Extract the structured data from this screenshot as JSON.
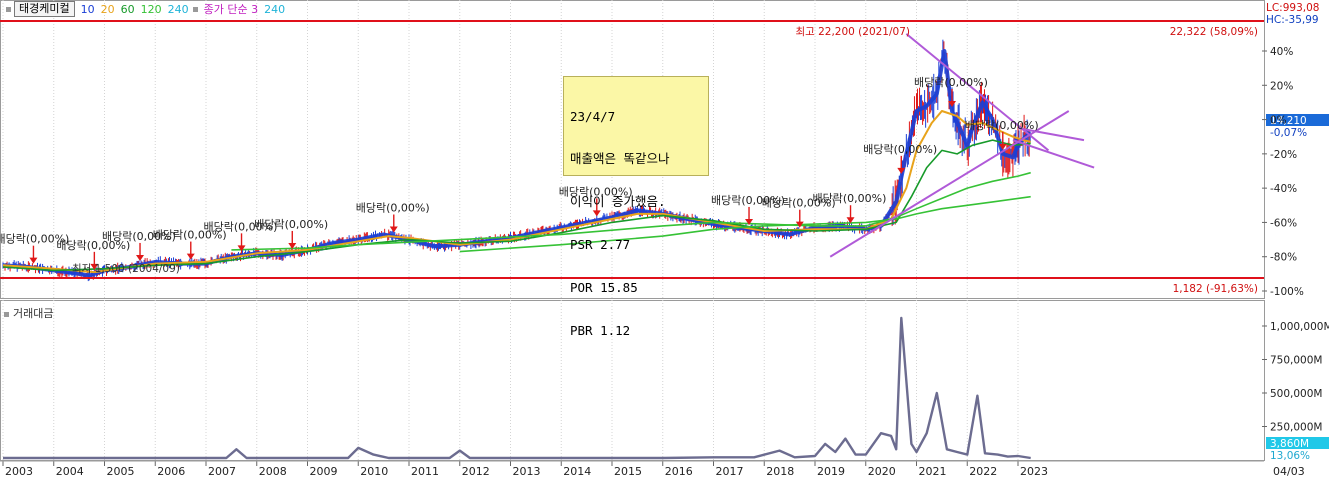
{
  "header": {
    "stock_name": "태경케미컬",
    "ma_periods": [
      "10",
      "20",
      "60",
      "120",
      "240"
    ],
    "ma_colors": [
      "#1a3fd6",
      "#e8a31b",
      "#179a2a",
      "#36c236",
      "#20b4d8"
    ],
    "vol_ma_label": "종가 단순 3",
    "vol_ma_period": "240"
  },
  "memo": {
    "lines": [
      "23/4/7",
      "매출액은 똑같으나",
      "이익이 증가했음.",
      "PSR 2.77",
      "POR 15.85",
      "PBR 1.12"
    ]
  },
  "price_chart": {
    "lc_label": "LC:993,08",
    "hc_label": "HC:-35,99",
    "high_line_label": "22,322 (58,09%)",
    "low_line_label": "1,182 (-91,63%)",
    "current_price_label": "14,210",
    "current_pct_label": "-0,07%",
    "high_note": "최고 22,200 (2021/07)",
    "low_note": "최저 1,500 (2004/09)",
    "pct_ticks": [
      "40%",
      "20%",
      "0%",
      "-20%",
      "-40%",
      "-60%",
      "-80%",
      "-100%"
    ]
  },
  "volume_chart": {
    "title": "거래대금",
    "ticks": [
      "1,000,000M",
      "750,000M",
      "500,000M",
      "250,000M"
    ],
    "current_label": "3,860M",
    "current_pct_label": "13,06%"
  },
  "x_axis": {
    "years": [
      "2003",
      "2004",
      "2005",
      "2006",
      "2007",
      "2008",
      "2009",
      "2010",
      "2011",
      "2012",
      "2013",
      "2014",
      "2015",
      "2016",
      "2017",
      "2018",
      "2019",
      "2020",
      "2021",
      "2022",
      "2023"
    ],
    "last_date": "04/03"
  },
  "dividends": [
    {
      "x": 2003.6,
      "label": "배당락(0,00%)"
    },
    {
      "x": 2004.8,
      "label": "배당락(0,00%)"
    },
    {
      "x": 2005.7,
      "label": "배당락(0,00%)"
    },
    {
      "x": 2006.7,
      "label": "배당락(0,00%)"
    },
    {
      "x": 2007.7,
      "label": "배당락(0,00%)"
    },
    {
      "x": 2008.7,
      "label": "배당락(0,00%)"
    },
    {
      "x": 2010.7,
      "label": "배당락(0,00%)"
    },
    {
      "x": 2014.7,
      "label": "배당락(0,00%)"
    },
    {
      "x": 2017.7,
      "label": "배당락(0,00%)"
    },
    {
      "x": 2018.7,
      "label": "배당락(0,00%)"
    },
    {
      "x": 2019.7,
      "label": "배당락(0,00%)"
    },
    {
      "x": 2020.7,
      "label": "배당락(0,00%)"
    },
    {
      "x": 2021.7,
      "label": "배당락(0,00%)"
    },
    {
      "x": 2022.7,
      "label": "배당락(0,00%)"
    }
  ],
  "chart_data": {
    "type": "line",
    "title": "태경케미컬",
    "x_range": [
      2003,
      2023.3
    ],
    "y_pct_range": [
      -100,
      55
    ],
    "high_pct": 58.09,
    "low_pct": -91.63,
    "series": [
      {
        "values_pct": [
          [
            2003.0,
            -85
          ],
          [
            2003.5,
            -86
          ],
          [
            2004.0,
            -88
          ],
          [
            2004.5,
            -90
          ],
          [
            2004.7,
            -91
          ],
          [
            2005.0,
            -88
          ],
          [
            2005.5,
            -86
          ],
          [
            2006.0,
            -83
          ],
          [
            2006.5,
            -84
          ],
          [
            2007.0,
            -84
          ],
          [
            2007.5,
            -80
          ],
          [
            2008.0,
            -78
          ],
          [
            2008.5,
            -79
          ],
          [
            2009.0,
            -76
          ],
          [
            2009.5,
            -72
          ],
          [
            2010.0,
            -70
          ],
          [
            2010.5,
            -67
          ],
          [
            2011.0,
            -70
          ],
          [
            2011.5,
            -74
          ],
          [
            2012.0,
            -73
          ],
          [
            2012.5,
            -71
          ],
          [
            2013.0,
            -69
          ],
          [
            2013.5,
            -66
          ],
          [
            2014.0,
            -63
          ],
          [
            2014.5,
            -60
          ],
          [
            2015.0,
            -57
          ],
          [
            2015.5,
            -53
          ],
          [
            2016.0,
            -55
          ],
          [
            2016.5,
            -58
          ],
          [
            2017.0,
            -61
          ],
          [
            2017.5,
            -63
          ],
          [
            2018.0,
            -65
          ],
          [
            2018.5,
            -67
          ],
          [
            2019.0,
            -63
          ],
          [
            2019.5,
            -62
          ],
          [
            2020.0,
            -64
          ],
          [
            2020.3,
            -62
          ],
          [
            2020.6,
            -48
          ],
          [
            2020.8,
            -20
          ],
          [
            2021.0,
            5
          ],
          [
            2021.2,
            8
          ],
          [
            2021.4,
            15
          ],
          [
            2021.55,
            40
          ],
          [
            2021.7,
            5
          ],
          [
            2021.9,
            -8
          ],
          [
            2022.0,
            -15
          ],
          [
            2022.1,
            -5
          ],
          [
            2022.3,
            10
          ],
          [
            2022.5,
            0
          ],
          [
            2022.7,
            -20
          ],
          [
            2022.9,
            -22
          ],
          [
            2023.0,
            -15
          ],
          [
            2023.15,
            -10
          ],
          [
            2023.25,
            -8
          ]
        ]
      },
      {
        "values_pct": [
          [
            2003.0,
            -85
          ],
          [
            2004.0,
            -87
          ],
          [
            2004.8,
            -89
          ],
          [
            2005.5,
            -86
          ],
          [
            2006.0,
            -84
          ],
          [
            2007.0,
            -83
          ],
          [
            2008.0,
            -78
          ],
          [
            2009.0,
            -76
          ],
          [
            2010.0,
            -71
          ],
          [
            2010.6,
            -68
          ],
          [
            2011.0,
            -69
          ],
          [
            2012.0,
            -73
          ],
          [
            2013.0,
            -70
          ],
          [
            2014.0,
            -64
          ],
          [
            2015.0,
            -58
          ],
          [
            2015.5,
            -55
          ],
          [
            2016.0,
            -55
          ],
          [
            2017.0,
            -60
          ],
          [
            2018.0,
            -65
          ],
          [
            2019.0,
            -64
          ],
          [
            2020.0,
            -64
          ],
          [
            2020.5,
            -58
          ],
          [
            2020.8,
            -40
          ],
          [
            2021.0,
            -18
          ],
          [
            2021.3,
            -2
          ],
          [
            2021.5,
            5
          ],
          [
            2021.8,
            2
          ],
          [
            2022.0,
            -3
          ],
          [
            2022.3,
            -2
          ],
          [
            2022.6,
            -6
          ],
          [
            2022.9,
            -10
          ],
          [
            2023.1,
            -12
          ],
          [
            2023.25,
            -13
          ]
        ]
      },
      {
        "values_pct": [
          [
            2003.0,
            -86
          ],
          [
            2004.0,
            -88
          ],
          [
            2005.0,
            -87
          ],
          [
            2006.0,
            -85
          ],
          [
            2007.0,
            -84
          ],
          [
            2008.0,
            -80
          ],
          [
            2009.0,
            -77
          ],
          [
            2010.0,
            -73
          ],
          [
            2011.0,
            -70
          ],
          [
            2012.0,
            -72
          ],
          [
            2013.0,
            -71
          ],
          [
            2014.0,
            -66
          ],
          [
            2015.0,
            -60
          ],
          [
            2016.0,
            -56
          ],
          [
            2017.0,
            -59
          ],
          [
            2018.0,
            -64
          ],
          [
            2019.0,
            -65
          ],
          [
            2020.0,
            -64
          ],
          [
            2020.6,
            -60
          ],
          [
            2020.9,
            -45
          ],
          [
            2021.2,
            -28
          ],
          [
            2021.5,
            -18
          ],
          [
            2021.8,
            -20
          ],
          [
            2022.1,
            -15
          ],
          [
            2022.5,
            -12
          ],
          [
            2022.9,
            -15
          ],
          [
            2023.25,
            -14
          ]
        ]
      },
      {
        "values_pct": [
          [
            2007.5,
            -76
          ],
          [
            2009.0,
            -75
          ],
          [
            2010.0,
            -73
          ],
          [
            2012.0,
            -70
          ],
          [
            2014.0,
            -67
          ],
          [
            2016.0,
            -62
          ],
          [
            2017.0,
            -60
          ],
          [
            2018.0,
            -61
          ],
          [
            2019.0,
            -62
          ],
          [
            2020.0,
            -62
          ],
          [
            2020.6,
            -57
          ],
          [
            2021.0,
            -52
          ],
          [
            2021.5,
            -46
          ],
          [
            2022.0,
            -40
          ],
          [
            2022.5,
            -36
          ],
          [
            2023.0,
            -33
          ],
          [
            2023.25,
            -31
          ]
        ]
      },
      {
        "values_pct": [
          [
            2012.0,
            -77
          ],
          [
            2014.0,
            -73
          ],
          [
            2016.0,
            -68
          ],
          [
            2017.0,
            -64
          ],
          [
            2018.0,
            -62
          ],
          [
            2019.0,
            -61
          ],
          [
            2020.0,
            -60
          ],
          [
            2020.6,
            -58
          ],
          [
            2021.0,
            -55
          ],
          [
            2021.5,
            -52
          ],
          [
            2022.0,
            -50
          ],
          [
            2022.5,
            -48
          ],
          [
            2023.0,
            -46
          ],
          [
            2023.25,
            -45
          ]
        ]
      }
    ],
    "trendlines_pct": [
      {
        "from": [
          2020.8,
          50
        ],
        "to": [
          2023.6,
          -18
        ]
      },
      {
        "from": [
          2019.3,
          -80
        ],
        "to": [
          2024.0,
          5
        ]
      },
      {
        "from": [
          2023.0,
          -5
        ],
        "to": [
          2024.3,
          -12
        ]
      }
    ],
    "volume": {
      "unit": "M",
      "y_range": [
        0,
        1100000
      ],
      "values": [
        [
          2003.0,
          15000
        ],
        [
          2007.4,
          15000
        ],
        [
          2007.6,
          80000
        ],
        [
          2007.8,
          15000
        ],
        [
          2009.8,
          15000
        ],
        [
          2010.0,
          90000
        ],
        [
          2010.3,
          40000
        ],
        [
          2010.6,
          15000
        ],
        [
          2011.8,
          15000
        ],
        [
          2012.0,
          70000
        ],
        [
          2012.2,
          15000
        ],
        [
          2016.0,
          15000
        ],
        [
          2017.0,
          20000
        ],
        [
          2017.8,
          20000
        ],
        [
          2018.3,
          70000
        ],
        [
          2018.6,
          20000
        ],
        [
          2019.0,
          30000
        ],
        [
          2019.2,
          120000
        ],
        [
          2019.4,
          60000
        ],
        [
          2019.6,
          160000
        ],
        [
          2019.8,
          40000
        ],
        [
          2020.0,
          40000
        ],
        [
          2020.3,
          200000
        ],
        [
          2020.5,
          180000
        ],
        [
          2020.6,
          80000
        ],
        [
          2020.7,
          1060000
        ],
        [
          2020.9,
          120000
        ],
        [
          2021.0,
          60000
        ],
        [
          2021.2,
          200000
        ],
        [
          2021.4,
          500000
        ],
        [
          2021.6,
          80000
        ],
        [
          2021.8,
          60000
        ],
        [
          2022.0,
          40000
        ],
        [
          2022.2,
          480000
        ],
        [
          2022.35,
          50000
        ],
        [
          2022.6,
          40000
        ],
        [
          2022.8,
          25000
        ],
        [
          2023.0,
          30000
        ],
        [
          2023.25,
          15000
        ]
      ]
    }
  }
}
